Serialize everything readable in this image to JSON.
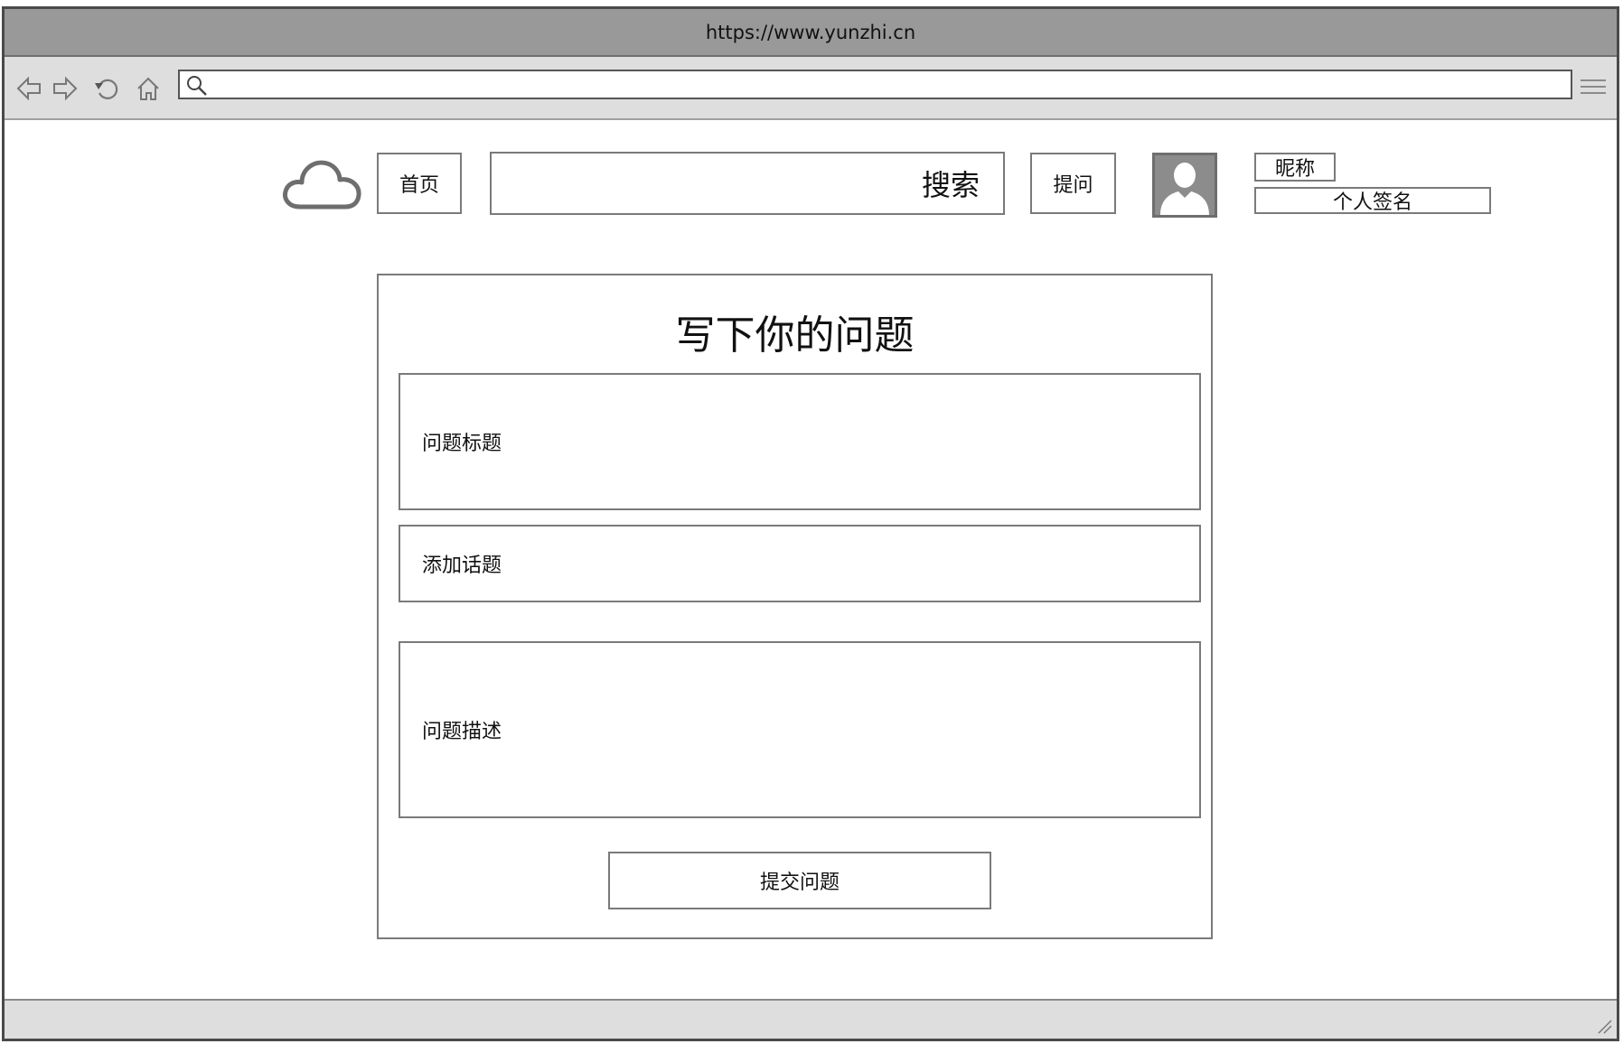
{
  "browser": {
    "url": "https://www.yunzhi.cn",
    "address_value": "",
    "icons": {
      "back": "back-arrow-icon",
      "forward": "forward-arrow-icon",
      "reload": "reload-icon",
      "home": "home-icon",
      "search": "search-icon",
      "menu": "hamburger-menu-icon",
      "resize": "resize-grip-icon"
    }
  },
  "header": {
    "logo": "cloud-icon",
    "home_label": "首页",
    "search_label": "搜索",
    "ask_label": "提问",
    "avatar": "user-avatar-icon",
    "nickname": "昵称",
    "signature": "个人签名"
  },
  "form": {
    "title": "写下你的问题",
    "question_title_placeholder": "问题标题",
    "add_topic_placeholder": "添加话题",
    "question_description_placeholder": "问题描述",
    "submit_label": "提交问题"
  },
  "colors": {
    "titlebar": "#999999",
    "toolbar": "#dedede",
    "border": "#7a7a7a",
    "icon_gray": "#6e6e6e"
  }
}
